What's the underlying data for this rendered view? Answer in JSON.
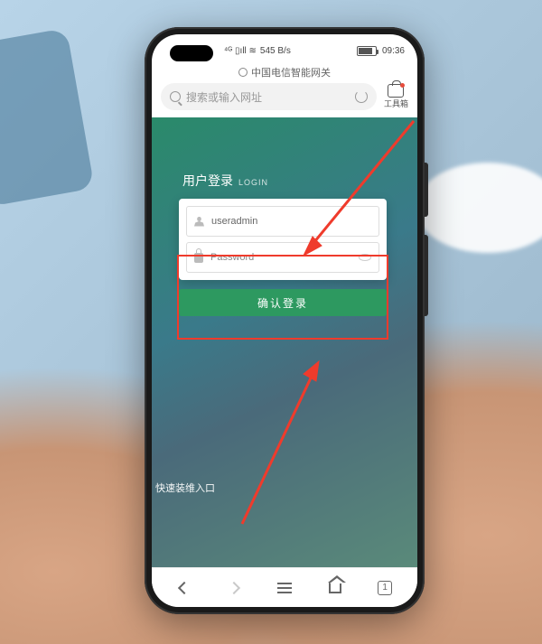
{
  "status": {
    "network": "4G",
    "signal": "⁴ᴳ ₐₗₗ",
    "speed": "545 B/s",
    "battery_icon": "battery",
    "time": "09:36"
  },
  "browser": {
    "page_title": "中国电信智能网关",
    "search_placeholder": "搜索或输入网址",
    "toolbox_label": "工具箱"
  },
  "login": {
    "title_cn": "用户登录",
    "title_en": "LOGIN",
    "username_value": "useradmin",
    "password_placeholder": "Password",
    "submit_label": "确认登录"
  },
  "quick_link": "快速装维入口",
  "nav": {
    "tab_count": "1"
  },
  "annotation": {
    "highlight_color": "#ef3b2c"
  }
}
